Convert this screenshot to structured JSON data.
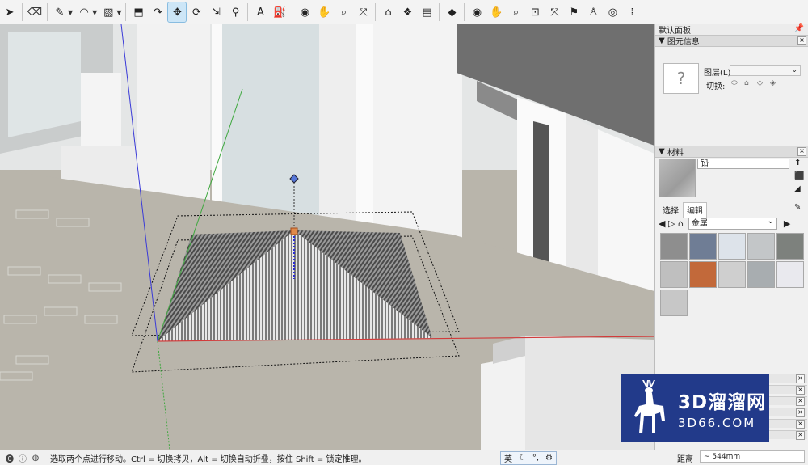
{
  "toolbar": {
    "tools": [
      {
        "name": "select-icon",
        "glyph": "➤",
        "active": false
      },
      {
        "name": "eraser-icon",
        "glyph": "⌫",
        "active": false
      },
      {
        "name": "pencil-icon",
        "glyph": "✎",
        "active": false,
        "dropdown": true
      },
      {
        "name": "arc-icon",
        "glyph": "◠",
        "active": false,
        "dropdown": true
      },
      {
        "name": "rectangle-icon",
        "glyph": "▧",
        "active": false,
        "dropdown": true
      },
      {
        "name": "push-pull-icon",
        "glyph": "⬒",
        "active": false
      },
      {
        "name": "follow-me-icon",
        "glyph": "↷",
        "active": false
      },
      {
        "name": "move-icon",
        "glyph": "✥",
        "active": true
      },
      {
        "name": "rotate-icon",
        "glyph": "⟳",
        "active": false
      },
      {
        "name": "scale-icon",
        "glyph": "⇲",
        "active": false
      },
      {
        "name": "tape-measure-icon",
        "glyph": "⚲",
        "active": false
      },
      {
        "name": "text-icon",
        "glyph": "A",
        "active": false
      },
      {
        "name": "paint-bucket-icon",
        "glyph": "⛽",
        "active": false
      },
      {
        "name": "orbit-icon",
        "glyph": "◉",
        "active": false
      },
      {
        "name": "pan-icon",
        "glyph": "✋",
        "active": false
      },
      {
        "name": "zoom-icon",
        "glyph": "⌕",
        "active": false
      },
      {
        "name": "zoom-extents-icon",
        "glyph": "⤧",
        "active": false
      },
      {
        "name": "3d-warehouse-icon",
        "glyph": "⌂",
        "active": false
      },
      {
        "name": "extension-warehouse-icon",
        "glyph": "❖",
        "active": false
      },
      {
        "name": "layout-icon",
        "glyph": "▤",
        "active": false
      },
      {
        "name": "ruby-icon",
        "glyph": "◆",
        "active": false
      },
      {
        "name": "orbit2-icon",
        "glyph": "◉",
        "active": false
      },
      {
        "name": "pan2-icon",
        "glyph": "✋",
        "active": false
      },
      {
        "name": "zoom2-icon",
        "glyph": "⌕",
        "active": false
      },
      {
        "name": "zoom-window-icon",
        "glyph": "⊡",
        "active": false
      },
      {
        "name": "zoom-extents2-icon",
        "glyph": "⤧",
        "active": false
      },
      {
        "name": "position-camera-icon",
        "glyph": "⚑",
        "active": false
      },
      {
        "name": "walk-icon",
        "glyph": "♙",
        "active": false
      },
      {
        "name": "look-around-icon",
        "glyph": "◎",
        "active": false
      },
      {
        "name": "footprints-icon",
        "glyph": "⁞",
        "active": false
      }
    ]
  },
  "panel": {
    "tray_title": "默认面板",
    "entity_info": {
      "title": "图元信息",
      "preview_glyph": "?",
      "layer_label": "图层(L):",
      "layer_value": "",
      "toggle_label": "切换:"
    },
    "materials": {
      "title": "材料",
      "material_name": "铅",
      "tabs": [
        "选择",
        "编辑"
      ],
      "collection": "金属",
      "swatch_colors": [
        "#8e8e8e",
        "#6f7d95",
        "#dde3ea",
        "#c3c6c8",
        "#7d817d",
        "#bfbfbf",
        "#c2693a",
        "#cfcfcf",
        "#a8adb0",
        "#e9e9ee",
        "#c7c7c7"
      ]
    }
  },
  "status": {
    "message": "选取两个点进行移动。Ctrl = 切换拷贝，Alt = 切换自动折叠，按住 Shift = 锁定推理。",
    "ime": "英",
    "measure_label": "距离",
    "measure_value": "~ 544mm"
  },
  "watermark": {
    "line1": "3D溜溜网",
    "line2": "3D66.COM"
  },
  "colors": {
    "viewport_floor": "#b9b5ab",
    "axis_red": "#d23b3b",
    "axis_green": "#3ea83e",
    "axis_blue": "#3a3ad8",
    "watermark_bg": "#223a8a"
  }
}
